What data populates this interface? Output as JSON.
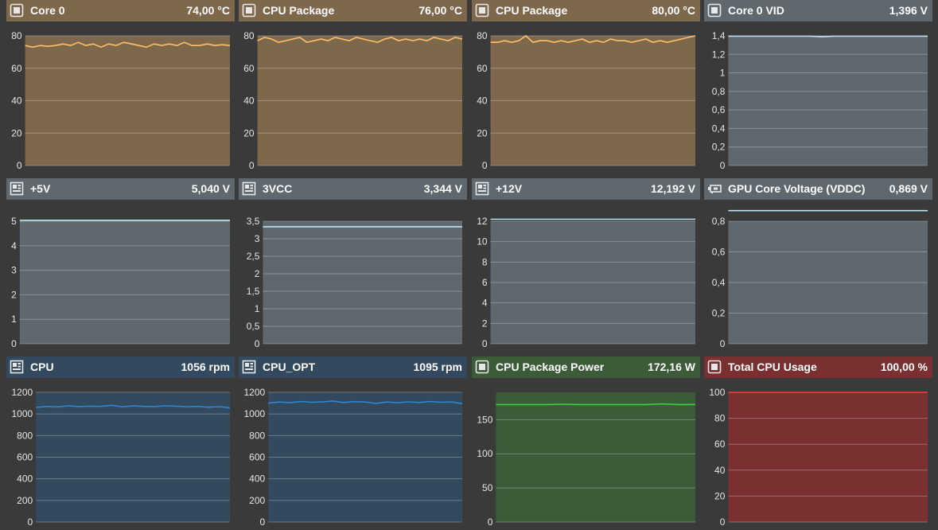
{
  "colors": {
    "background": "#3a3a3a",
    "temp_header": "#7e684c",
    "temp_plot": "#7e684c",
    "temp_line": "#ffbf6e",
    "volt_header": "#5e686e",
    "volt_plot": "#5e686e",
    "volt_line": "#bde3f2",
    "fan_header": "#33495d",
    "fan_plot": "#33495d",
    "fan_line": "#2e86d2",
    "power_header": "#3b5b39",
    "power_plot": "#3b5b39",
    "power_line": "#3fcf3a",
    "usage_header": "#7a3031",
    "usage_plot": "#7a3031",
    "usage_line": "#ff3a3a",
    "grid": "rgba(255,255,255,0.28)"
  },
  "panels": [
    {
      "name": "Core 0",
      "value": "74,00 °C",
      "icon": "cpu-chip-icon",
      "theme": "temp"
    },
    {
      "name": "CPU Package",
      "value": "76,00 °C",
      "icon": "cpu-chip-icon",
      "theme": "temp"
    },
    {
      "name": "CPU Package",
      "value": "80,00 °C",
      "icon": "cpu-chip-icon",
      "theme": "temp"
    },
    {
      "name": "Core 0 VID",
      "value": "1,396 V",
      "icon": "cpu-chip-icon",
      "theme": "volt"
    },
    {
      "name": "+5V",
      "value": "5,040 V",
      "icon": "motherboard-icon",
      "theme": "volt"
    },
    {
      "name": "3VCC",
      "value": "3,344 V",
      "icon": "motherboard-icon",
      "theme": "volt"
    },
    {
      "name": "+12V",
      "value": "12,192 V",
      "icon": "motherboard-icon",
      "theme": "volt"
    },
    {
      "name": "GPU Core Voltage (VDDC)",
      "value": "0,869 V",
      "icon": "gpu-card-icon",
      "theme": "volt"
    },
    {
      "name": "CPU",
      "value": "1056 rpm",
      "icon": "motherboard-icon",
      "theme": "fan"
    },
    {
      "name": "CPU_OPT",
      "value": "1095 rpm",
      "icon": "motherboard-icon",
      "theme": "fan"
    },
    {
      "name": "CPU Package Power",
      "value": "172,16 W",
      "icon": "cpu-chip-icon",
      "theme": "power"
    },
    {
      "name": "Total CPU Usage",
      "value": "100,00 %",
      "icon": "cpu-chip-icon",
      "theme": "usage"
    }
  ],
  "chart_data": [
    {
      "type": "line",
      "ticks": [
        "0",
        "20",
        "40",
        "60",
        "80"
      ],
      "ylim": [
        0,
        80
      ],
      "series": [
        {
          "values": [
            74,
            73,
            74,
            73.5,
            74,
            75,
            74,
            76,
            74,
            75,
            73,
            75,
            74,
            76,
            75,
            74,
            73,
            75,
            74,
            75,
            74,
            76,
            74,
            74,
            75,
            74,
            74.5,
            74
          ]
        }
      ]
    },
    {
      "type": "line",
      "ticks": [
        "0",
        "20",
        "40",
        "60",
        "80"
      ],
      "ylim": [
        0,
        80
      ],
      "series": [
        {
          "values": [
            77,
            79,
            78,
            76,
            77,
            78,
            79,
            76,
            77,
            78,
            77,
            79,
            78,
            77,
            79,
            78,
            77,
            76,
            78,
            79,
            77,
            78,
            77,
            78,
            77,
            79,
            78,
            77,
            79,
            78
          ]
        }
      ]
    },
    {
      "type": "line",
      "ticks": [
        "0",
        "20",
        "40",
        "60",
        "80"
      ],
      "ylim": [
        0,
        80
      ],
      "series": [
        {
          "values": [
            76,
            76,
            77,
            76,
            77,
            80,
            76,
            77,
            77,
            76,
            77,
            76,
            77,
            78,
            76,
            77,
            76,
            78,
            77,
            77,
            76,
            77,
            78,
            76,
            77,
            76,
            77,
            78,
            79,
            80
          ]
        }
      ]
    },
    {
      "type": "line",
      "ticks": [
        "0",
        "0,2",
        "0,4",
        "0,6",
        "0,8",
        "1",
        "1,2",
        "1,4"
      ],
      "ylim": [
        0,
        1.4
      ],
      "series": [
        {
          "values": [
            1.396,
            1.396,
            1.396,
            1.396,
            1.396,
            1.396,
            1.396,
            1.396,
            1.39,
            1.396,
            1.396,
            1.396,
            1.396,
            1.396,
            1.396,
            1.396,
            1.396,
            1.396
          ]
        }
      ]
    },
    {
      "type": "line",
      "ticks": [
        "0",
        "1",
        "2",
        "3",
        "4",
        "5"
      ],
      "ylim": [
        0,
        5
      ],
      "series": [
        {
          "values": [
            5.04,
            5.04,
            5.04,
            5.04,
            5.04,
            5.04,
            5.04,
            5.04
          ]
        }
      ]
    },
    {
      "type": "line",
      "ticks": [
        "0",
        "0,5",
        "1",
        "1,5",
        "2",
        "2,5",
        "3",
        "3,5"
      ],
      "ylim": [
        0,
        3.5
      ],
      "series": [
        {
          "values": [
            3.344,
            3.344,
            3.344,
            3.344,
            3.344,
            3.344,
            3.344,
            3.344
          ]
        }
      ]
    },
    {
      "type": "line",
      "ticks": [
        "0",
        "2",
        "4",
        "6",
        "8",
        "10",
        "12"
      ],
      "ylim": [
        0,
        12
      ],
      "series": [
        {
          "values": [
            12.192,
            12.192,
            12.192,
            12.192,
            12.192,
            12.192,
            12.192,
            12.192
          ]
        }
      ]
    },
    {
      "type": "line",
      "ticks": [
        "0",
        "0,2",
        "0,4",
        "0,6",
        "0,8"
      ],
      "ylim": [
        0,
        0.8
      ],
      "series": [
        {
          "values": [
            0.869,
            0.869,
            0.869,
            0.869,
            0.869,
            0.869,
            0.869,
            0.869
          ]
        }
      ]
    },
    {
      "type": "line",
      "ticks": [
        "0",
        "200",
        "400",
        "600",
        "800",
        "1000",
        "1200"
      ],
      "ylim": [
        0,
        1200
      ],
      "series": [
        {
          "values": [
            1060,
            1070,
            1065,
            1075,
            1068,
            1072,
            1070,
            1080,
            1066,
            1074,
            1070,
            1068,
            1075,
            1072,
            1066,
            1070,
            1062,
            1068,
            1056
          ]
        }
      ]
    },
    {
      "type": "line",
      "ticks": [
        "0",
        "200",
        "400",
        "600",
        "800",
        "1000",
        "1200"
      ],
      "ylim": [
        0,
        1200
      ],
      "series": [
        {
          "values": [
            1100,
            1110,
            1105,
            1115,
            1108,
            1112,
            1120,
            1106,
            1114,
            1110,
            1098,
            1110,
            1104,
            1112,
            1106,
            1115,
            1108,
            1112,
            1095
          ]
        }
      ]
    },
    {
      "type": "line",
      "ticks": [
        "0",
        "50",
        "100",
        "150"
      ],
      "ylim": [
        0,
        190
      ],
      "series": [
        {
          "values": [
            172,
            172,
            172,
            172,
            172.5,
            172,
            172,
            172,
            172,
            172,
            173,
            172,
            172.16
          ]
        }
      ]
    },
    {
      "type": "line",
      "ticks": [
        "0",
        "20",
        "40",
        "60",
        "80",
        "100"
      ],
      "ylim": [
        0,
        100
      ],
      "series": [
        {
          "values": [
            100,
            100,
            100,
            100,
            100,
            100,
            100,
            100
          ]
        }
      ]
    }
  ]
}
